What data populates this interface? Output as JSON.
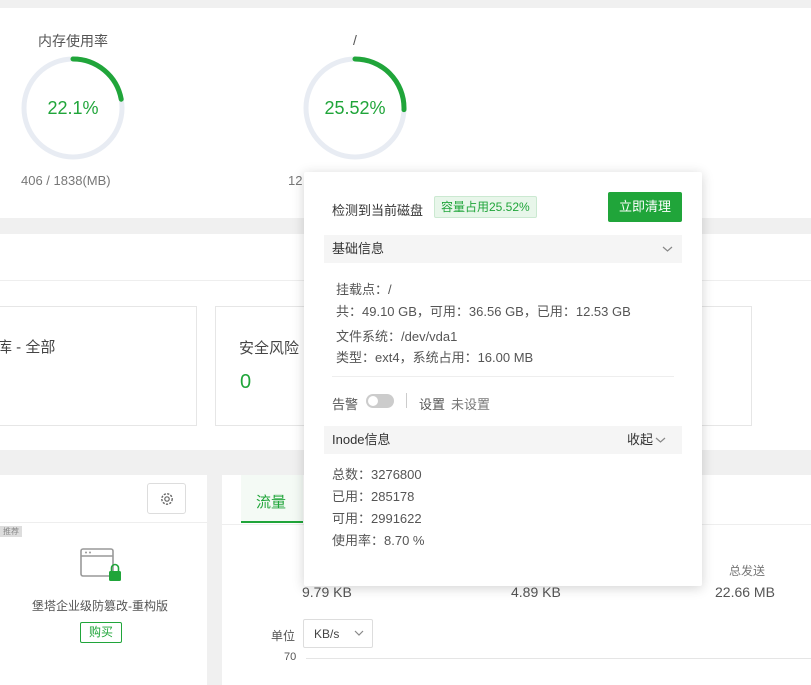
{
  "gauges": [
    {
      "title": "内存使用率",
      "value": "22.1%",
      "sub": "406 / 1838(MB)",
      "percent": 22.1
    },
    {
      "title": "/",
      "value": "25.52%",
      "sub": "12",
      "percent": 25.52
    }
  ],
  "security": {
    "library_label": "库 - 全部",
    "risk_label": "安全风险",
    "risk_value": "0"
  },
  "plugin": {
    "badge": "推荐",
    "name": "堡塔企业级防篡改-重构版",
    "buy_label": "购买"
  },
  "traffic": {
    "tab_label": "流量",
    "stat1": "9.79 KB",
    "stat2": "4.89 KB",
    "stat3_label": "总发送",
    "stat3": "22.66 MB",
    "unit_label": "单位",
    "unit_value": "KB/s",
    "y_tick": "70"
  },
  "popover": {
    "title": "检测到当前磁盘",
    "usage_badge": "容量占用25.52%",
    "clean_button": "立即清理",
    "basic_section": "基础信息",
    "mount_point": "挂载点：/",
    "totals": "共：49.10 GB，可用：36.56 GB，已用：12.53 GB",
    "filesystem": "文件系统：/dev/vda1",
    "type_line": "类型：ext4，系统占用：16.00 MB",
    "alert_label": "告警",
    "settings_link": "设置",
    "not_set": "未设置",
    "inode_section": "Inode信息",
    "collapse_label": "收起",
    "inode_total": "总数：3276800",
    "inode_used": "已用：285178",
    "inode_free": "可用：2991622",
    "inode_rate": "使用率：8.70 %"
  },
  "colors": {
    "accent": "#20a53a",
    "track": "#e8ecf3",
    "badge_bg": "#e8f6ea"
  }
}
